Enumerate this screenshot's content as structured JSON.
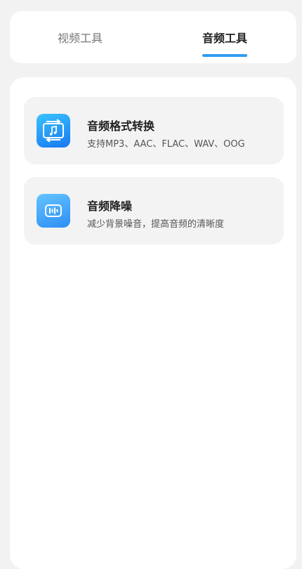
{
  "tabs": [
    {
      "label": "视频工具",
      "active": false
    },
    {
      "label": "音频工具",
      "active": true
    }
  ],
  "accent_color": "#2f9df4",
  "tools": [
    {
      "title": "音频格式转换",
      "desc": "支持MP3、AAC、FLAC、WAV、OOG",
      "icon": "audio-convert-icon"
    },
    {
      "title": "音频降噪",
      "desc": "减少背景噪音，提高音频的清晰度",
      "icon": "audio-denoise-icon"
    }
  ]
}
